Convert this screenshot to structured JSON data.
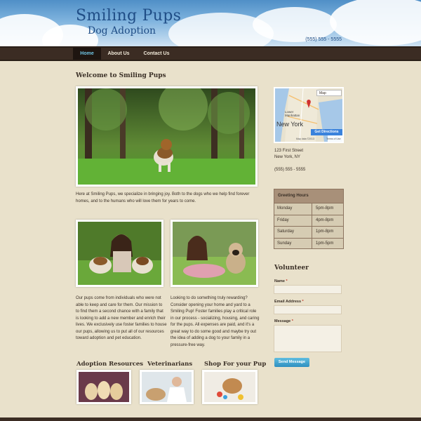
{
  "header": {
    "title": "Smiling Pups",
    "subtitle": "Dog Adoption",
    "phone": "(555) 555 - 5555"
  },
  "nav": {
    "items": [
      {
        "label": "Home",
        "active": true
      },
      {
        "label": "About Us",
        "active": false
      },
      {
        "label": "Contact Us",
        "active": false
      }
    ]
  },
  "main": {
    "welcome_title": "Welcome to Smiling Pups",
    "intro": "Here at Smiling Pups, we specialize in bringing joy. Both to the dogs who we help find forever homes, and to the humans who will love them for years to come.",
    "col_left": "Our pups come from individuals who were not able to keep and care for them. Our mission to to find them a second chance with a family that is looking to add a new member and enrich their lives. We exclusively use foster families to house our pups, allowing us to put all of our resources toward adoption and pet education.",
    "col_right": "Looking to do something truly rewarding? Consider opening your home and yard to a Smiling Pup! Foster families play a critical role in our process - socializing, housing, and caring for the pups. All expenses are paid, and it's a great way to do some good and maybe try out the idea of adding a dog to your family in a pressure-free way.",
    "sections": [
      {
        "title": "Adoption Resources"
      },
      {
        "title": "Veterinarians"
      },
      {
        "title": "Shop For your Pup"
      }
    ]
  },
  "sidebar": {
    "map": {
      "type_label": "Map",
      "city_label": "New York",
      "district_label": "Lower Manhattan",
      "directions_label": "Get Directions",
      "credit": "Map data ©2013",
      "terms": "Terms of Use"
    },
    "address_line1": "123 First Street",
    "address_line2": "New York, NY",
    "phone": "(555) 555 - 5555",
    "hours_title": "Greeting Hours",
    "hours": [
      {
        "day": "Monday",
        "time": "5pm-8pm"
      },
      {
        "day": "Friday",
        "time": "4pm-8pm"
      },
      {
        "day": "Saturday",
        "time": "1pm-8pm"
      },
      {
        "day": "Sunday",
        "time": "1pm-5pm"
      }
    ],
    "volunteer": {
      "title": "Volunteer",
      "name_label": "Name",
      "email_label": "Email Address",
      "message_label": "Message",
      "required_mark": "*",
      "send_label": "Send Message"
    }
  }
}
